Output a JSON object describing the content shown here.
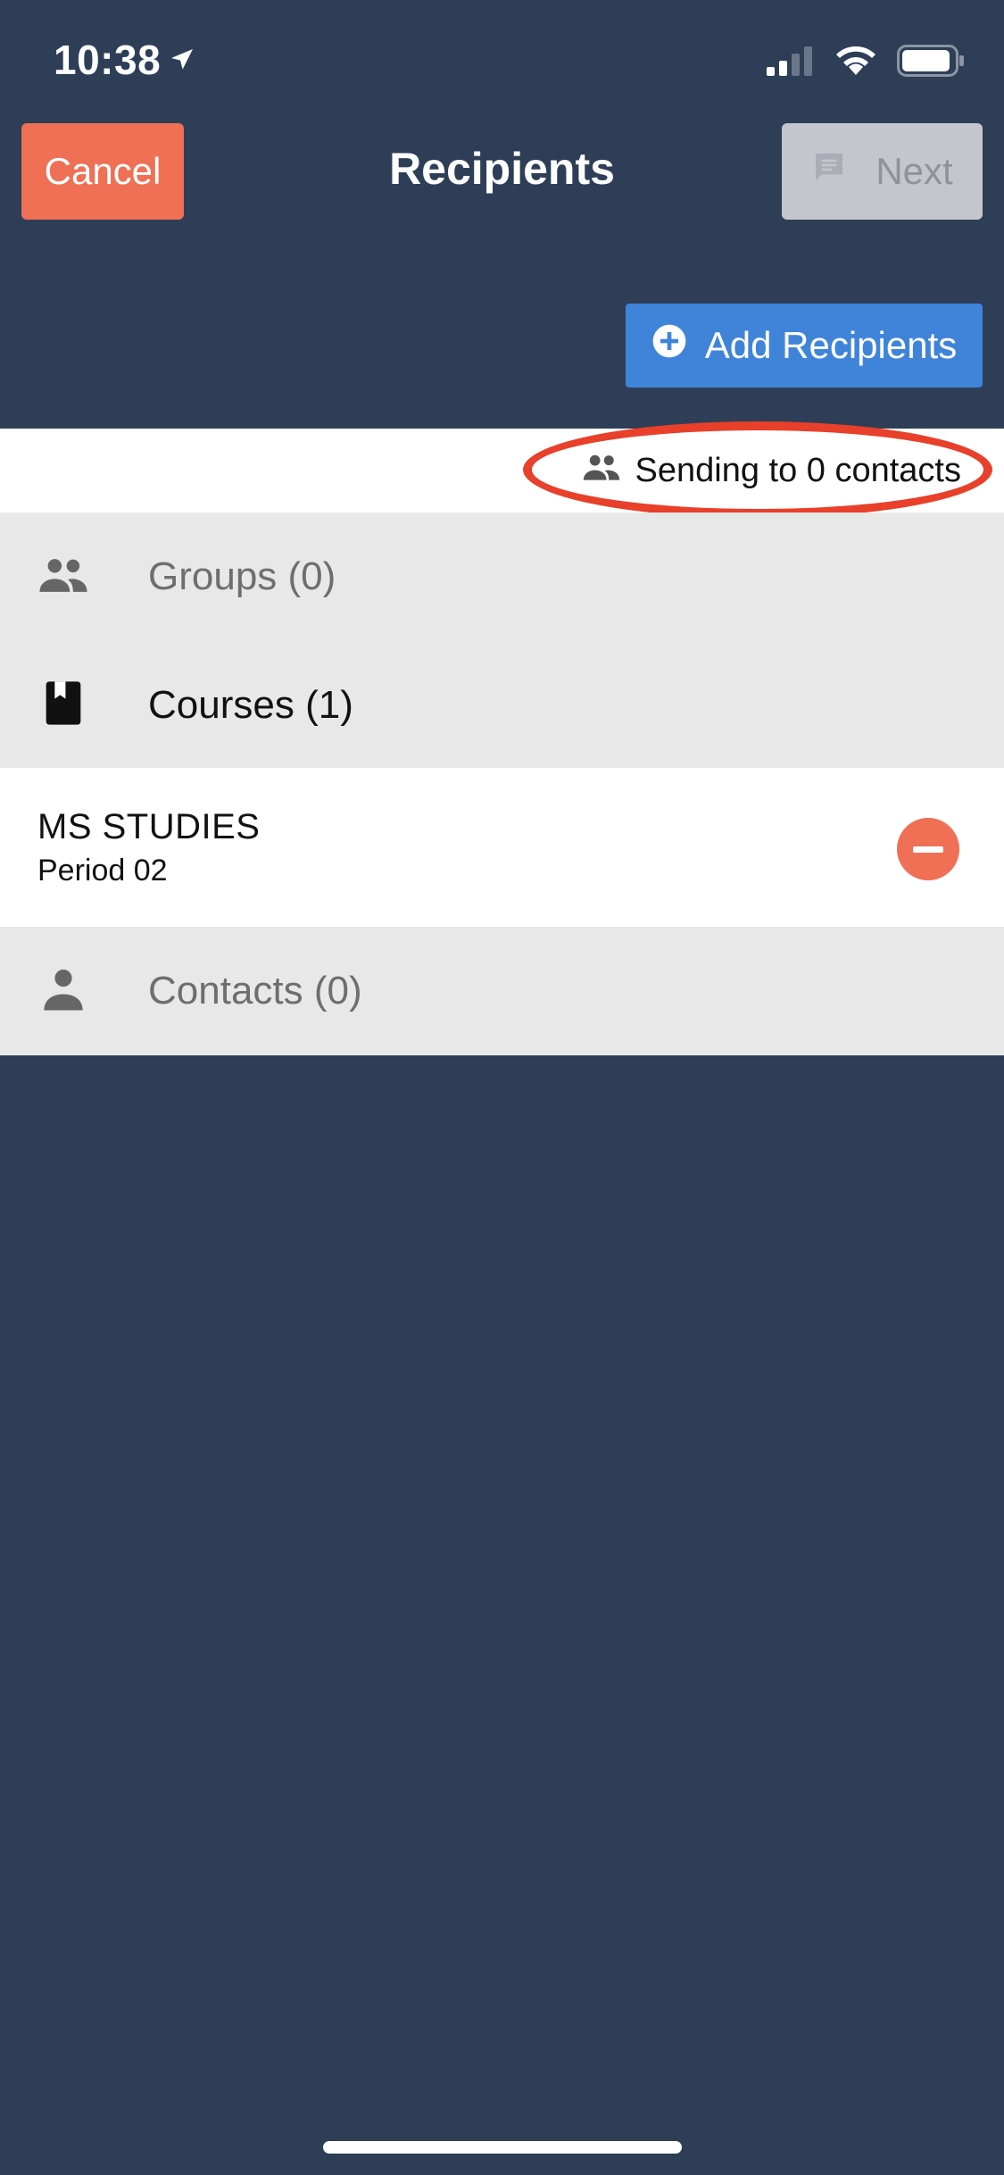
{
  "status_bar": {
    "time": "10:38"
  },
  "nav": {
    "cancel_label": "Cancel",
    "title": "Recipients",
    "next_label": "Next"
  },
  "add_recipients_label": "Add Recipients",
  "summary": {
    "text": "Sending to 0 contacts"
  },
  "sections": {
    "groups": {
      "label": "Groups (0)"
    },
    "courses": {
      "label": "Courses (1)"
    },
    "contacts": {
      "label": "Contacts (0)"
    }
  },
  "courses": [
    {
      "title": "MS STUDIES",
      "subtitle": "Period 02"
    }
  ],
  "colors": {
    "background": "#2e3e57",
    "cancel": "#ef7054",
    "add_button": "#3f84d9",
    "next_disabled": "#c3c7cd",
    "annotation": "#e8402a"
  }
}
